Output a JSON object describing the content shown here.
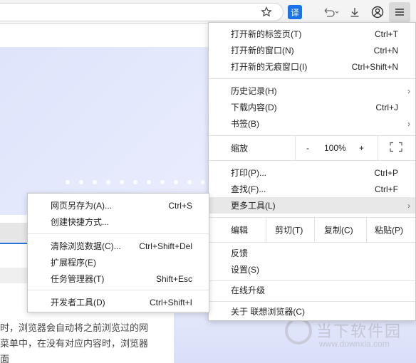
{
  "toolbar": {
    "translate_label": "译",
    "icons": [
      "star-icon",
      "translate-icon",
      "undo-icon",
      "download-icon",
      "account-icon",
      "menu-icon"
    ]
  },
  "page": {
    "paragraph": [
      "时，浏览器会自动将之前浏览过的网",
      "菜单中，在没有对应内容时，浏览器",
      "面"
    ]
  },
  "main_menu": {
    "new_tab": {
      "label": "打开新的标签页(T)",
      "shortcut": "Ctrl+T"
    },
    "new_window": {
      "label": "打开新的窗口(N)",
      "shortcut": "Ctrl+N"
    },
    "incognito": {
      "label": "打开新的无痕窗口(I)",
      "shortcut": "Ctrl+Shift+N"
    },
    "history": {
      "label": "历史记录(H)"
    },
    "downloads": {
      "label": "下载内容(D)",
      "shortcut": "Ctrl+J"
    },
    "bookmarks": {
      "label": "书签(B)"
    },
    "zoom": {
      "label": "缩放",
      "minus": "-",
      "value": "100%",
      "plus": "+"
    },
    "print": {
      "label": "打印(P)...",
      "shortcut": "Ctrl+P"
    },
    "find": {
      "label": "查找(F)...",
      "shortcut": "Ctrl+F"
    },
    "more_tools": {
      "label": "更多工具(L)"
    },
    "edit": {
      "label": "编辑",
      "cut": "剪切(T)",
      "copy": "复制(C)",
      "paste": "粘贴(P)"
    },
    "feedback": {
      "label": "反馈"
    },
    "settings": {
      "label": "设置(S)"
    },
    "upgrade": {
      "label": "在线升级"
    },
    "about": {
      "label": "关于 联想浏览器(C)"
    }
  },
  "sub_menu": {
    "save_as": {
      "label": "网页另存为(A)...",
      "shortcut": "Ctrl+S"
    },
    "shortcut": {
      "label": "创建快捷方式..."
    },
    "clear_data": {
      "label": "清除浏览数据(C)...",
      "shortcut": "Ctrl+Shift+Del"
    },
    "extensions": {
      "label": "扩展程序(E)"
    },
    "task_manager": {
      "label": "任务管理器(T)",
      "shortcut": "Shift+Esc"
    },
    "devtools": {
      "label": "开发者工具(D)",
      "shortcut": "Ctrl+Shift+I"
    }
  },
  "watermark": {
    "title": "当下软件园",
    "url": "www.downxia.com"
  }
}
